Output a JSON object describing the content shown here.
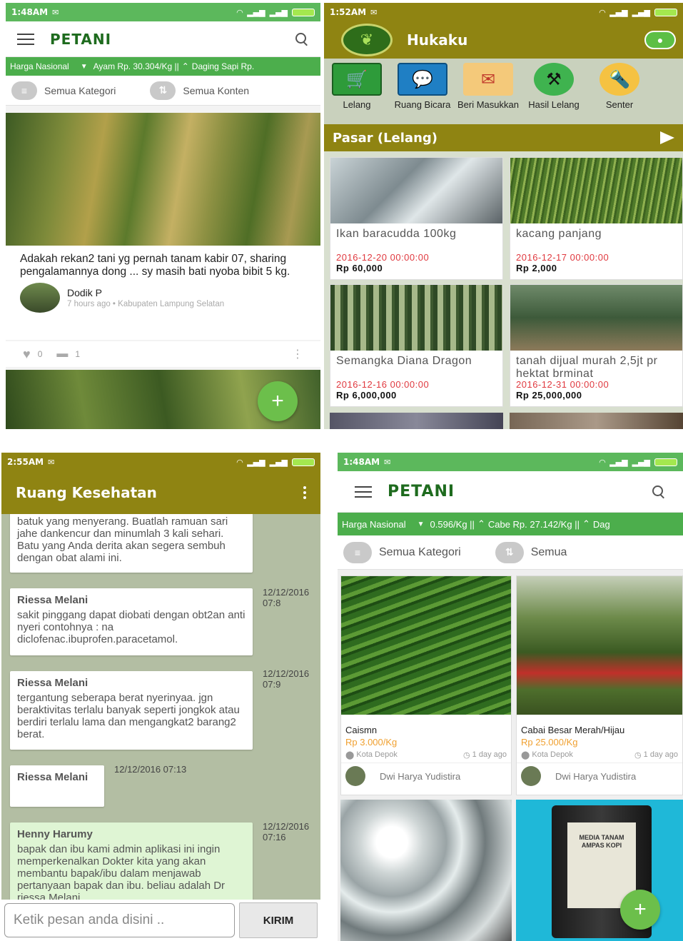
{
  "p1": {
    "status": {
      "time": "1:48AM"
    },
    "app_logo": "PETANI",
    "ticker": {
      "label": "Harga Nasional",
      "text": "Ayam Rp. 30.304/Kg ||",
      "text2": "Daging Sapi Rp."
    },
    "filters": {
      "category": "Semua Kategori",
      "content": "Semua Konten"
    },
    "post": {
      "text": "Adakah rekan2 tani yg pernah tanam kabir 07, sharing pengalamannya dong ... sy masih bati nyoba bibit 5 kg.",
      "author": "Dodik P",
      "meta": "7 hours ago • Kabupaten Lampung Selatan",
      "likes": "0",
      "comments": "1"
    },
    "fab": "+"
  },
  "p2": {
    "status": {
      "time": "1:52AM"
    },
    "title": "Hukaku",
    "menu": [
      {
        "label": "Lelang"
      },
      {
        "label": "Ruang Bicara"
      },
      {
        "label": "Beri Masukkan"
      },
      {
        "label": "Hasil Lelang"
      },
      {
        "label": "Senter"
      }
    ],
    "section": "Pasar (Lelang)",
    "items": [
      {
        "title": "Ikan baracudda 100kg",
        "date": "2016-12-20 00:00:00",
        "price": "Rp 60,000"
      },
      {
        "title": "kacang panjang",
        "date": "2016-12-17 00:00:00",
        "price": "Rp 2,000"
      },
      {
        "title": "Semangka Diana Dragon",
        "date": "2016-12-16 00:00:00",
        "price": "Rp 6,000,000"
      },
      {
        "title": "tanah dijual murah 2,5jt pr hektat brminat",
        "date": "2016-12-31 00:00:00",
        "price": "Rp 25,000,000"
      }
    ]
  },
  "p3": {
    "status": {
      "time": "2:55AM"
    },
    "title": "Ruang Kesehatan",
    "messages": [
      {
        "name": "",
        "text": "batuk yang menyerang. Buatlah ramuan sari jahe dankencur dan minumlah 3 kali sehari. Batu yang Anda derita akan segera sembuh dengan obat alami ini.",
        "time": ""
      },
      {
        "name": "Riessa Melani",
        "text": "sakit pinggang dapat diobati dengan obt2an anti nyeri contohnya : na diclofenac.ibuprofen.paracetamol.",
        "time": "12/12/2016 07:8"
      },
      {
        "name": "Riessa Melani",
        "text": "tergantung seberapa berat nyerinyaa. jgn beraktivitas terlalu banyak seperti jongkok atau berdiri terlalu lama dan mengangkat2 barang2 berat.",
        "time": "12/12/2016 07:9"
      },
      {
        "name": "Riessa Melani",
        "text": "",
        "time": "12/12/2016 07:13"
      },
      {
        "name": "Henny Harumy",
        "text": "bapak dan ibu kami admin aplikasi ini ingin memperkenalkan Dokter kita yang akan membantu bapak/ibu dalam menjawab pertanyaan bapak dan ibu. beliau adalah Dr riessa Melani",
        "time": "12/12/2016 07:16"
      }
    ],
    "input_placeholder": "Ketik pesan anda disini ..",
    "send": "KIRIM"
  },
  "p4": {
    "status": {
      "time": "1:48AM"
    },
    "app_logo": "PETANI",
    "ticker": {
      "label": "Harga Nasional",
      "text": "0.596/Kg ||",
      "text2": "Cabe Rp. 27.142/Kg ||",
      "text3": "Dag"
    },
    "filters": {
      "category": "Semua Kategori",
      "content": "Semua"
    },
    "products": [
      {
        "name": "Caismn",
        "price": "Rp 3.000/Kg",
        "location": "Kota Depok",
        "age": "1 day ago",
        "seller": "Dwi Harya Yudistira"
      },
      {
        "name": "Cabai Besar Merah/Hijau",
        "price": "Rp 25.000/Kg",
        "location": "Kota Depok",
        "age": "1 day ago",
        "seller": "Dwi Harya Yudistira"
      }
    ],
    "bag_label": "MEDIA TANAM AMPAS KOPI",
    "fab": "+"
  }
}
